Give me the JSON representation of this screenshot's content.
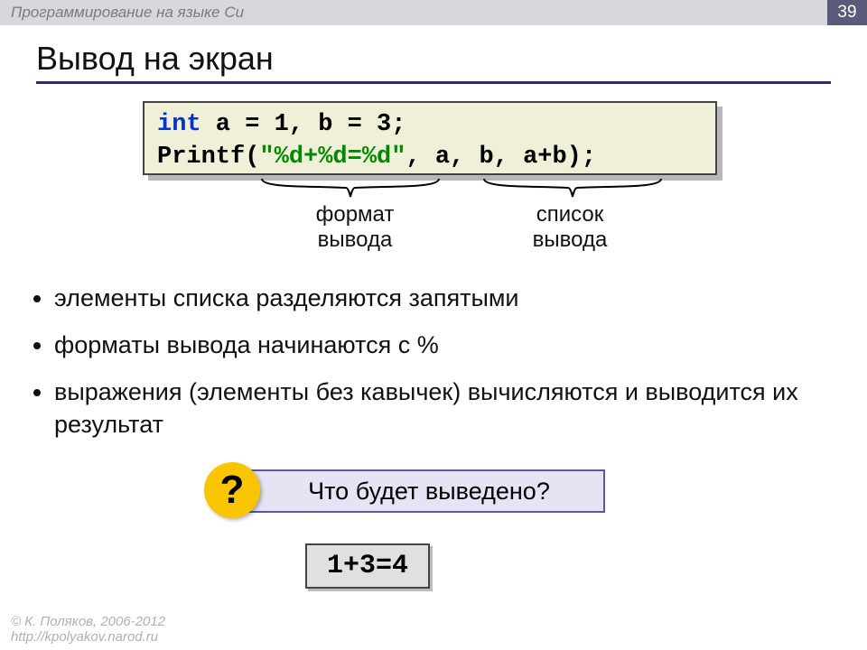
{
  "header": {
    "course": "Программирование на языке Си",
    "page_number": "39"
  },
  "title": "Вывод на экран",
  "code": {
    "line1_kw": "int",
    "line1_rest": " a = 1, b = 3;",
    "line2_fn": "Printf(",
    "line2_str": "\"%d+%d=%d\"",
    "line2_rest": ", a, b, a+b);"
  },
  "annotations": {
    "format_l1": "формат",
    "format_l2": "вывода",
    "list_l1": "список",
    "list_l2": "вывода"
  },
  "bullets": [
    "элементы списка разделяются запятыми",
    "форматы вывода начинаются с %",
    "выражения (элементы без кавычек) вычисляются и выводится их результат"
  ],
  "question": {
    "badge": "?",
    "text": "Что будет выведено?"
  },
  "answer": "1+3=4",
  "footer": {
    "copyright": "© К. Поляков, 2006-2012",
    "url": "http://kpolyakov.narod.ru"
  }
}
